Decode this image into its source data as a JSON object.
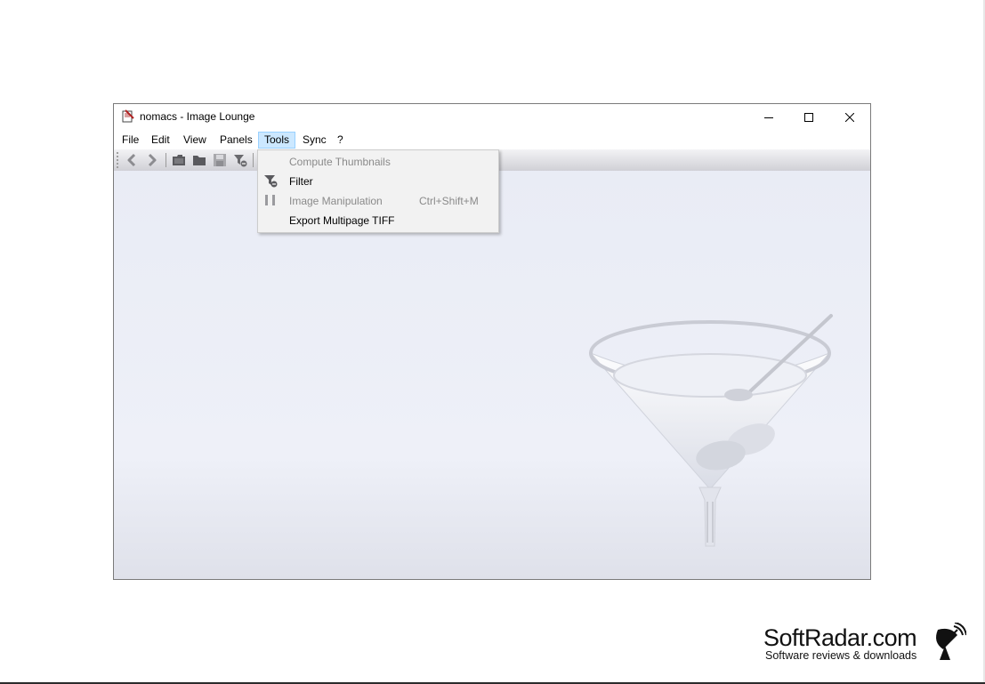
{
  "window": {
    "title": "nomacs - Image Lounge",
    "controls": {
      "minimize_icon": "minimize-icon",
      "maximize_icon": "maximize-icon",
      "close_icon": "close-icon"
    }
  },
  "menubar": {
    "items": [
      {
        "label": "File"
      },
      {
        "label": "Edit"
      },
      {
        "label": "View"
      },
      {
        "label": "Panels"
      },
      {
        "label": "Tools",
        "active": true
      },
      {
        "label": "Sync"
      },
      {
        "label": "?"
      }
    ]
  },
  "toolbar": {
    "icons": [
      "back-icon",
      "forward-icon",
      "open-file-icon",
      "open-folder-icon",
      "save-icon",
      "filter-icon"
    ]
  },
  "tools_menu": {
    "items": [
      {
        "label": "Compute Thumbnails",
        "enabled": false
      },
      {
        "label": "Filter",
        "enabled": true,
        "icon": "filter-icon"
      },
      {
        "label": "Image Manipulation",
        "shortcut": "Ctrl+Shift+M",
        "enabled": false,
        "icon": "manipulation-icon"
      },
      {
        "label": "Export Multipage TIFF",
        "enabled": true
      }
    ]
  },
  "watermark": {
    "brand": "SoftRadar.com",
    "tagline": "Software reviews & downloads"
  },
  "colors": {
    "menu_active_bg": "#cce8ff",
    "menu_active_border": "#99d1ff",
    "viewport_bg": "#e9ecf5",
    "dropdown_bg": "#f2f2f2",
    "disabled_text": "#8a8a8a"
  }
}
